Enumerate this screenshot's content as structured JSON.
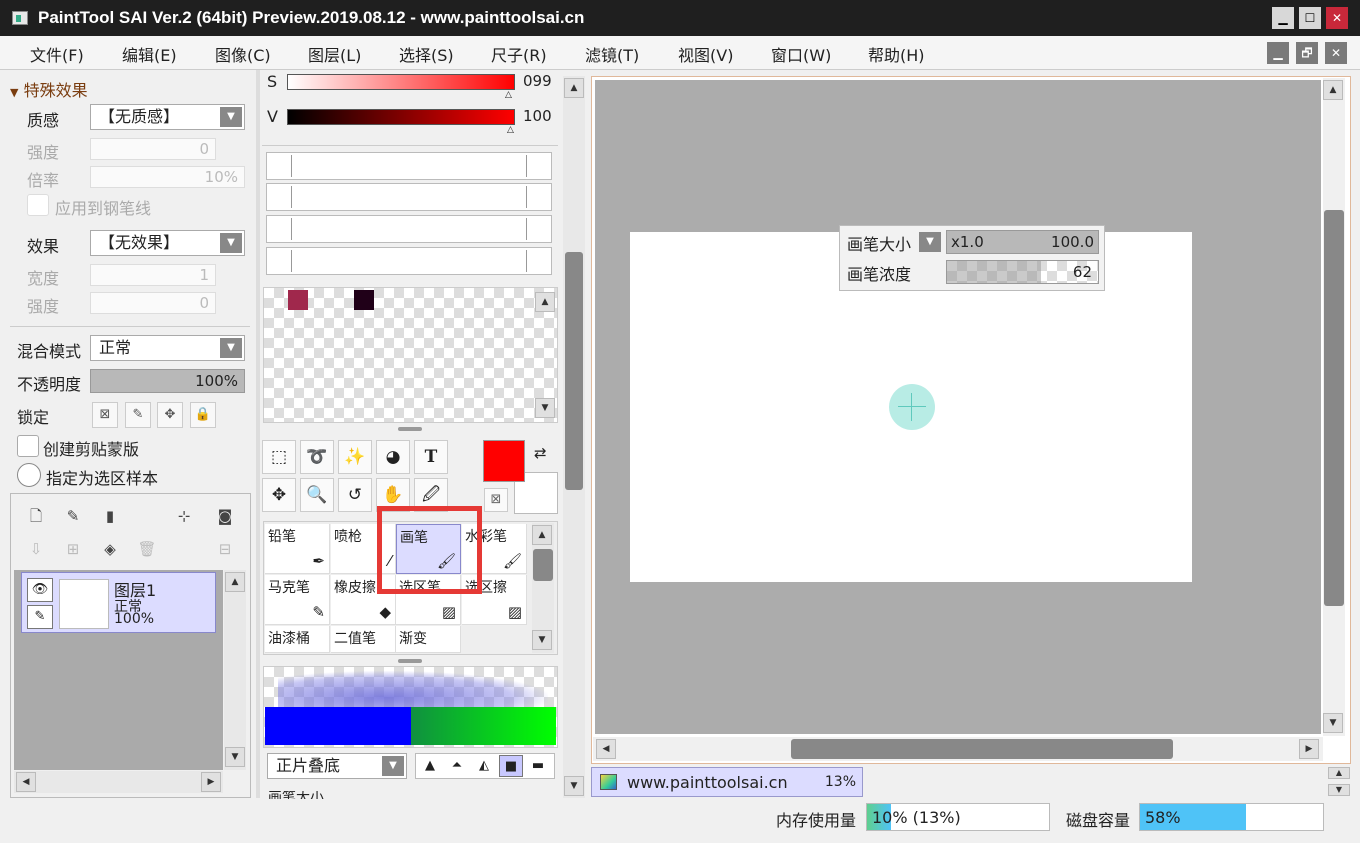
{
  "window": {
    "title": "PaintTool SAI Ver.2 (64bit) Preview.2019.08.12 - www.painttoolsai.cn",
    "min": "▁",
    "max": "☐",
    "close": "✕"
  },
  "menu": [
    "文件(F)",
    "编辑(E)",
    "图像(C)",
    "图层(L)",
    "选择(S)",
    "尺子(R)",
    "滤镜(T)",
    "视图(V)",
    "窗口(W)",
    "帮助(H)"
  ],
  "mdi": {
    "min": "▁",
    "restore": "🗗",
    "close": "✕"
  },
  "effects": {
    "section_title": "特殊效果",
    "texture_label": "质感",
    "texture_value": "【无质感】",
    "strength_label": "强度",
    "strength_value": "0",
    "ratio_label": "倍率",
    "ratio_value": "10%",
    "apply_pen": "应用到钢笔线",
    "effect_label": "效果",
    "effect_value": "【无效果】",
    "width_label": "宽度",
    "width_value": "1",
    "strength2_label": "强度",
    "strength2_value": "0"
  },
  "layer_props": {
    "blend_label": "混合模式",
    "blend_value": "正常",
    "opacity_label": "不透明度",
    "opacity_value": "100%",
    "opacity_fraction": 1.0,
    "lock_label": "锁定",
    "clip_label": "创建剪贴蒙版",
    "sample_label": "指定为选区样本"
  },
  "layer": {
    "name": "图层1",
    "mode": "正常",
    "opacity": "100%"
  },
  "color": {
    "s_label": "S",
    "s_value": "099",
    "v_label": "V",
    "v_value": "100",
    "primary": "#ff0000",
    "secondary": "#ffffff",
    "swatches": [
      "#a0284c",
      "#200018"
    ]
  },
  "tools": [
    "selection-icon",
    "lasso-icon",
    "magic-wand-icon",
    "shape-icon",
    "text-icon",
    "move-icon",
    "zoom-icon",
    "rotate-icon",
    "hand-icon",
    "eyedropper-icon"
  ],
  "text_tool_glyph": "T",
  "brushes": [
    "铅笔",
    "喷枪",
    "画笔",
    "水彩笔",
    "马克笔",
    "橡皮擦",
    "选区笔",
    "选区擦",
    "油漆桶",
    "二值笔",
    "渐变"
  ],
  "selected_brush": "画笔",
  "brush_settings": {
    "blend_value": "正片叠底",
    "next_label": "画笔大小"
  },
  "canvas_popup": {
    "size_label": "画笔大小",
    "size_mult": "x1.0",
    "size_value": "100.0",
    "density_label": "画笔浓度",
    "density_value": "62",
    "density_fraction": 0.62
  },
  "doc_tab": {
    "name": "www.painttoolsai.cn",
    "zoom": "13%"
  },
  "statusbar": {
    "memory_label": "内存使用量",
    "memory_value": "10% (13%)",
    "memory_fraction": 0.1,
    "disk_label": "磁盘容量",
    "disk_value": "58%",
    "disk_fraction": 0.58
  },
  "colors": {
    "highlight": "#e53935",
    "accent_blue": "#4fc3f7",
    "memory_green": "#5fcf8f"
  }
}
